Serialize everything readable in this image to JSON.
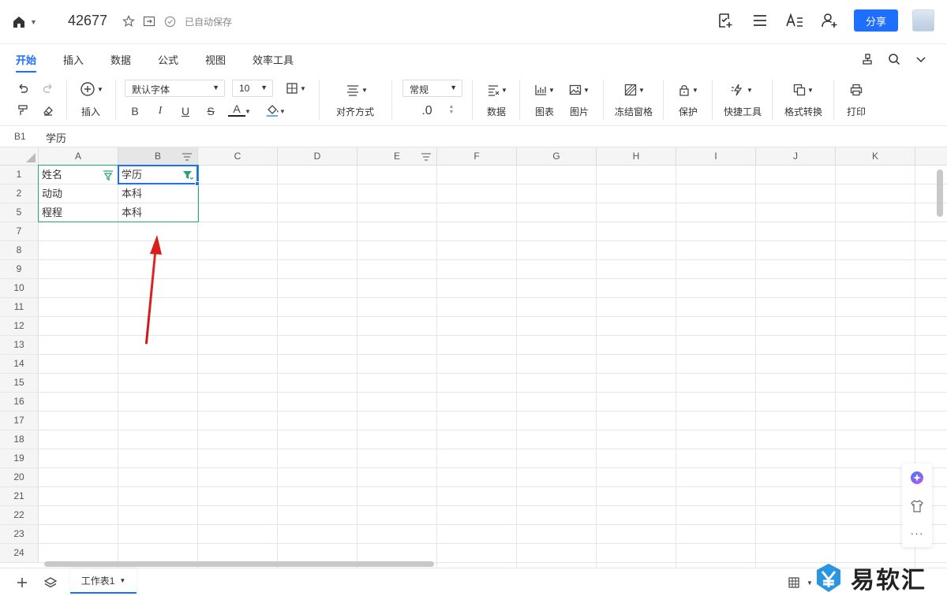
{
  "topbar": {
    "doc_title": "42677",
    "autosave": "已自动保存",
    "share_label": "分享"
  },
  "tabs": [
    {
      "label": "开始",
      "active": true
    },
    {
      "label": "插入",
      "active": false
    },
    {
      "label": "数据",
      "active": false
    },
    {
      "label": "公式",
      "active": false
    },
    {
      "label": "视图",
      "active": false
    },
    {
      "label": "效率工具",
      "active": false
    }
  ],
  "toolbar": {
    "insert_label": "插入",
    "font_name": "默认字体",
    "font_size": "10",
    "bold": "B",
    "italic": "I",
    "underline": "U",
    "strike": "S",
    "font_color_glyph": "A",
    "align_label": "对齐方式",
    "number_format": "常规",
    "decimal": ".0",
    "data_label": "数据",
    "chart_label": "图表",
    "image_label": "图片",
    "freeze_label": "冻结窗格",
    "protect_label": "保护",
    "quick_tools_label": "快捷工具",
    "format_convert_label": "格式转换",
    "print_label": "打印",
    "accent_color": "#1f6fff"
  },
  "formula_bar": {
    "cell_ref": "B1",
    "value": "学历"
  },
  "grid": {
    "columns": [
      "A",
      "B",
      "C",
      "D",
      "E",
      "F",
      "G",
      "H",
      "I",
      "J",
      "K"
    ],
    "rows": [
      "1",
      "2",
      "5",
      "7",
      "8",
      "9",
      "10",
      "11",
      "12",
      "13",
      "14",
      "15",
      "16",
      "17",
      "18",
      "19",
      "20",
      "21",
      "22",
      "23",
      "24"
    ],
    "cells": {
      "A1": "姓名",
      "B1": "学历",
      "A2": "动动",
      "B2": "本科",
      "A5": "程程",
      "B5": "本科"
    },
    "selected_cell": "B1",
    "filter_color": "#27a37a"
  },
  "bottom": {
    "sheet_name": "工作表1"
  },
  "watermark": {
    "text": "易软汇"
  }
}
